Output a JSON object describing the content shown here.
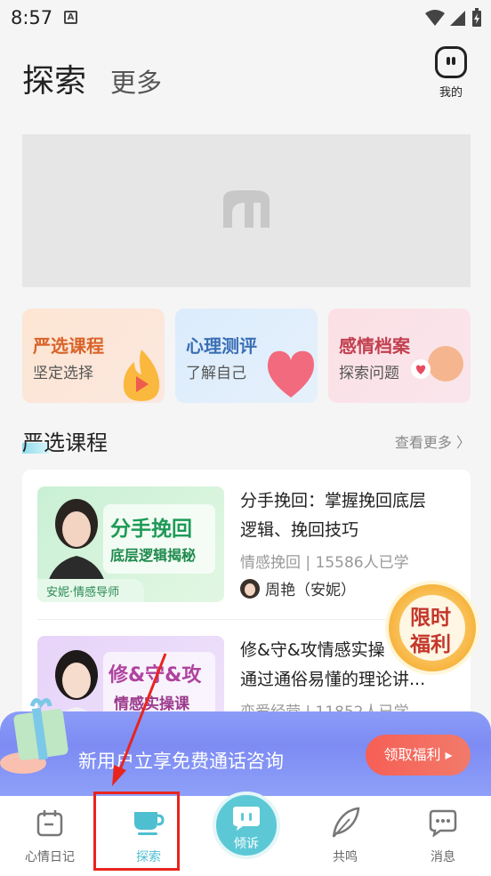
{
  "status_bar": {
    "time": "8:57",
    "notice_icon": "A"
  },
  "header": {
    "tab_active": "探索",
    "tab_more": "更多",
    "profile_label": "我的"
  },
  "categories": [
    {
      "title": "严选课程",
      "subtitle": "坚定选择",
      "title_color": "#d9642a"
    },
    {
      "title": "心理测评",
      "subtitle": "了解自己",
      "title_color": "#3a6fb5"
    },
    {
      "title": "感情档案",
      "subtitle": "探索问题",
      "title_color": "#c2404f"
    }
  ],
  "section": {
    "title": "严选课程",
    "more": "查看更多 〉"
  },
  "courses": [
    {
      "thumb_title": "分手挽回",
      "thumb_sub": "底层逻辑揭秘",
      "thumb_caption": "安妮·情感导师",
      "title": "分手挽回：掌握挽回底层逻辑、挽回技巧",
      "line1": "分手挽回：掌握挽回底层",
      "line2": "逻辑、挽回技巧",
      "meta": "情感挽回 | 15586人已学",
      "teacher": "周艳（安妮）"
    },
    {
      "thumb_title": "修&守&攻",
      "thumb_sub": "情感实操课",
      "line1": "修&守&攻情感实操",
      "line2": "通过通俗易懂的理论讲...",
      "meta": "恋爱经营 | 11852人已学"
    }
  ],
  "badge": {
    "line1": "限时",
    "line2": "福利"
  },
  "promo": {
    "text": "新用户立享免费通话咨询",
    "button": "领取福利 ▸"
  },
  "nav": {
    "diary": "心情日记",
    "explore": "探索",
    "talk": "倾诉",
    "resonate": "共鸣",
    "messages": "消息"
  },
  "colors": {
    "accent": "#5cc8d6",
    "annotation": "#e8241e"
  }
}
